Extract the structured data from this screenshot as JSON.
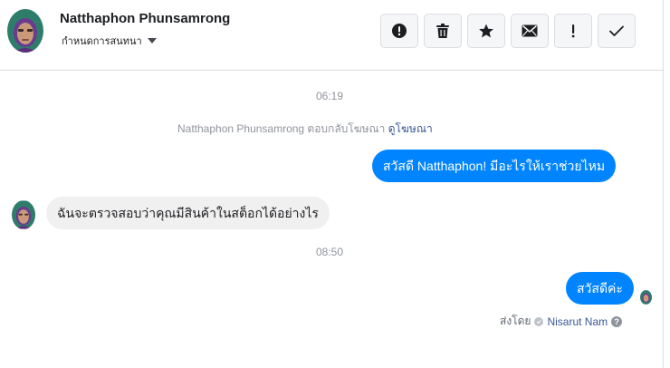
{
  "header": {
    "contact_name": "Natthaphon Phunsamrong",
    "subtitle": "กำหนดการสนทนา",
    "actions": [
      {
        "name": "report-spam-button",
        "icon": "exclamation-circle-icon"
      },
      {
        "name": "delete-button",
        "icon": "trash-icon"
      },
      {
        "name": "star-button",
        "icon": "star-icon"
      },
      {
        "name": "mark-unread-button",
        "icon": "envelope-icon"
      },
      {
        "name": "mark-important-button",
        "icon": "exclamation-icon"
      },
      {
        "name": "mark-done-button",
        "icon": "check-icon"
      }
    ]
  },
  "conversation": {
    "time_1": "06:19",
    "system_text": "Natthaphon Phunsamrong ตอบกลับโฆษณา",
    "system_link": "ดูโฆษณา",
    "message_out_1": "สวัสดี Natthaphon! มีอะไรให้เราช่วยไหม",
    "message_in_1": "ฉันจะตรวจสอบว่าคุณมีสินค้าในสต็อกได้อย่างไร",
    "time_2": "08:50",
    "message_out_2": "สวัสดีค่ะ",
    "sent_by_prefix": "ส่งโดย",
    "sent_by_name": "Nisarut Nam"
  },
  "colors": {
    "outgoing_bubble": "#0084ff",
    "incoming_bubble": "#f1f0f0",
    "link": "#385898",
    "meta_text": "#90949c"
  }
}
